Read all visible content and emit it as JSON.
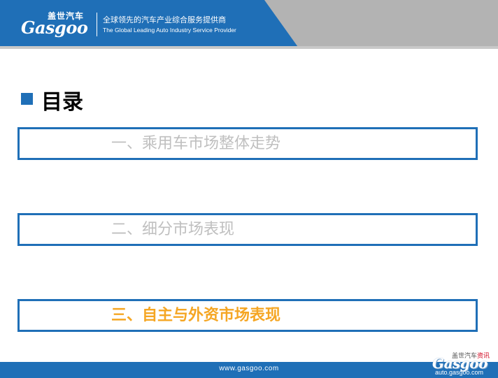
{
  "header": {
    "logo_cn": "盖世汽车",
    "logo_en": "Gasgoo",
    "tagline_cn": "全球领先的汽车产业综合服务提供商",
    "tagline_en": "The Global Leading Auto Industry Service Provider"
  },
  "title": "目录",
  "toc": [
    {
      "label": "一、乘用车市场整体走势",
      "active": false
    },
    {
      "label": "二、细分市场表现",
      "active": false
    },
    {
      "label": "三、自主与外资市场表现",
      "active": true
    }
  ],
  "footer": {
    "url": "www.gasgoo.com"
  },
  "watermark": {
    "cn_prefix": "盖世汽车",
    "cn_suffix": "资讯",
    "logo": "Gasgoo",
    "url": "auto.gasgoo.com"
  },
  "colors": {
    "brand_blue": "#1f6fb7",
    "header_gray": "#b3b3b3",
    "inactive_text": "#bfbfbf",
    "active_text": "#f5a623"
  }
}
